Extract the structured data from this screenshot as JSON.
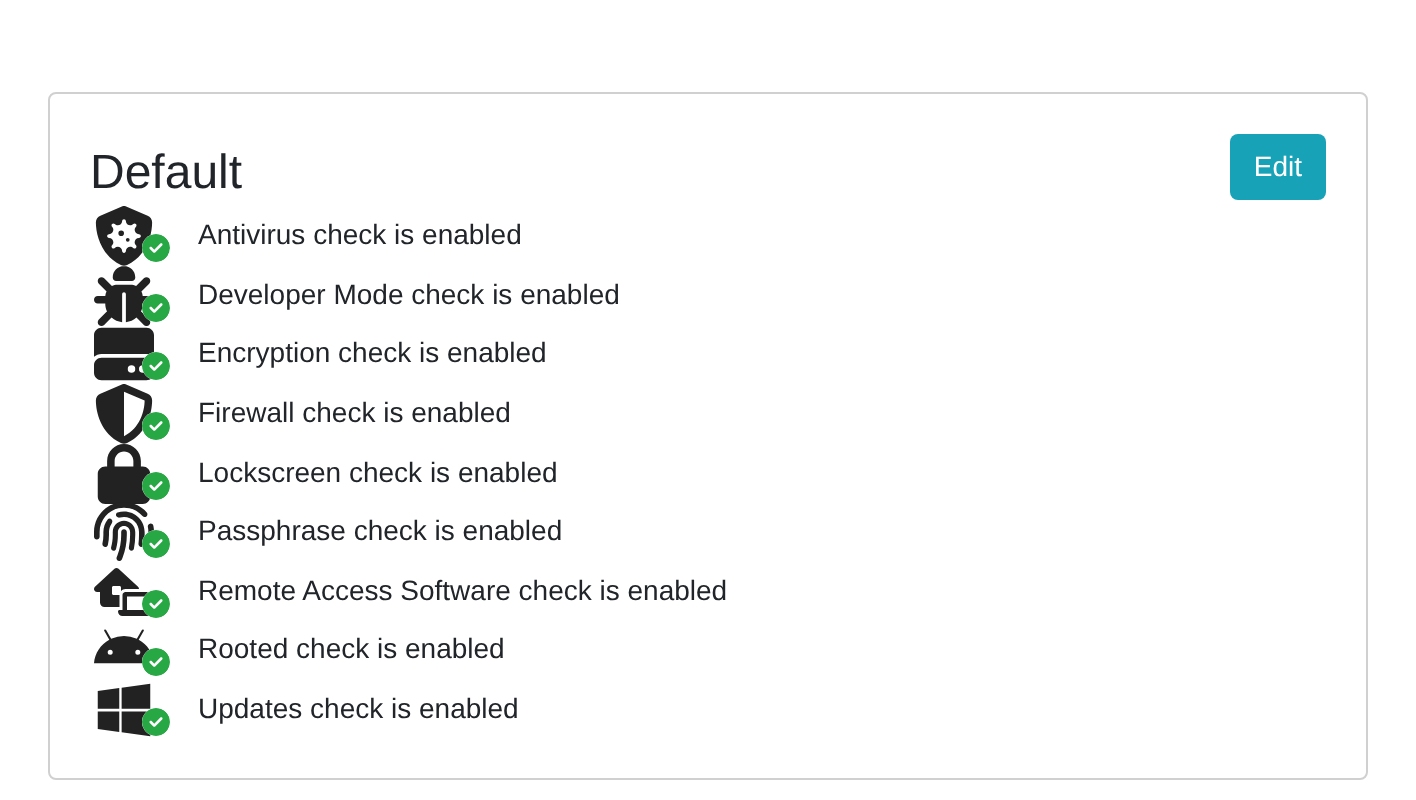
{
  "card": {
    "title": "Default",
    "edit_button": "Edit"
  },
  "checks": [
    {
      "kind": "antivirus",
      "label": "Antivirus check is enabled",
      "enabled": true
    },
    {
      "kind": "developer",
      "label": "Developer Mode check is enabled",
      "enabled": true
    },
    {
      "kind": "encryption",
      "label": "Encryption check is enabled",
      "enabled": true
    },
    {
      "kind": "firewall",
      "label": "Firewall check is enabled",
      "enabled": true
    },
    {
      "kind": "lockscreen",
      "label": "Lockscreen check is enabled",
      "enabled": true
    },
    {
      "kind": "passphrase",
      "label": "Passphrase check is enabled",
      "enabled": true
    },
    {
      "kind": "remote",
      "label": "Remote Access Software check is enabled",
      "enabled": true
    },
    {
      "kind": "rooted",
      "label": "Rooted check is enabled",
      "enabled": true
    },
    {
      "kind": "updates",
      "label": "Updates check is enabled",
      "enabled": true
    }
  ]
}
